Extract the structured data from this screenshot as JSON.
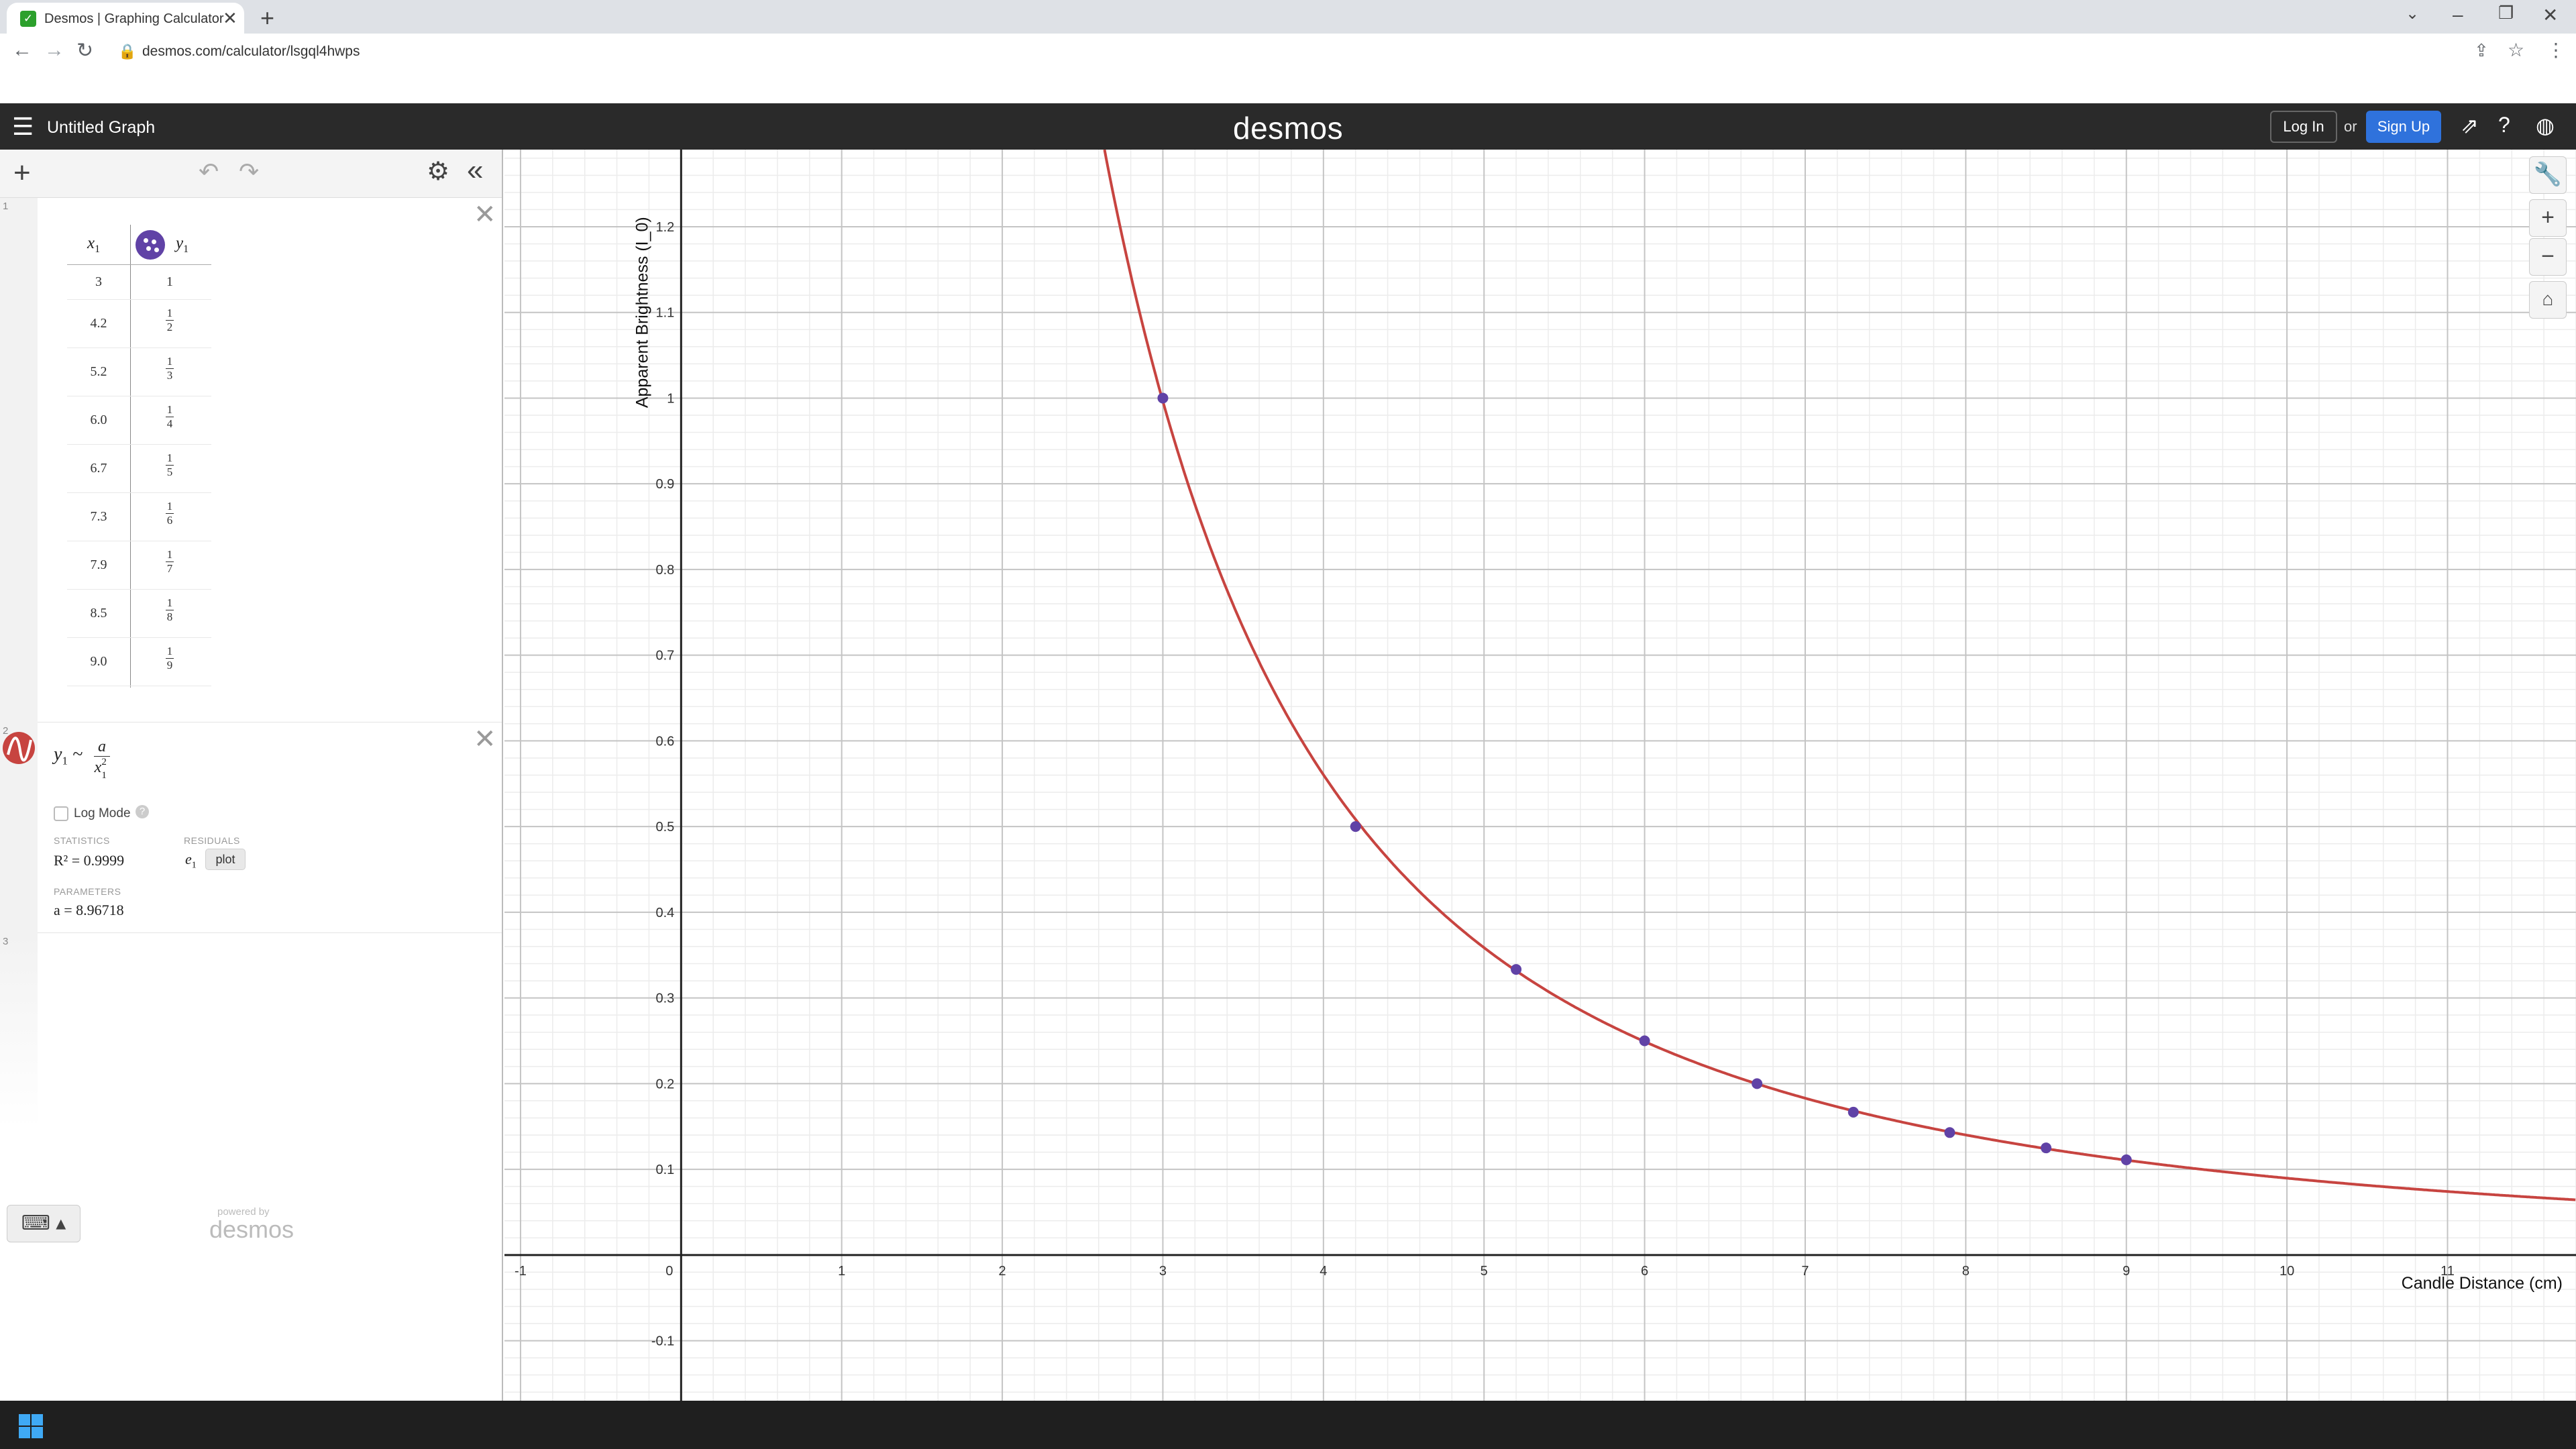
{
  "browser": {
    "tab_title": "Desmos | Graphing Calculator",
    "url": "desmos.com/calculator/lsgql4hwps"
  },
  "header": {
    "graph_title": "Untitled Graph",
    "logo": "desmos",
    "login": "Log In",
    "or": "or",
    "signup": "Sign Up"
  },
  "expressions": {
    "table": {
      "number": "1",
      "x_header": "x",
      "x_sub": "1",
      "y_header": "y",
      "y_sub": "1",
      "rows": [
        {
          "x": "3",
          "y_num": "1",
          "y_den": ""
        },
        {
          "x": "4.2",
          "y_num": "1",
          "y_den": "2"
        },
        {
          "x": "5.2",
          "y_num": "1",
          "y_den": "3"
        },
        {
          "x": "6.0",
          "y_num": "1",
          "y_den": "4"
        },
        {
          "x": "6.7",
          "y_num": "1",
          "y_den": "5"
        },
        {
          "x": "7.3",
          "y_num": "1",
          "y_den": "6"
        },
        {
          "x": "7.9",
          "y_num": "1",
          "y_den": "7"
        },
        {
          "x": "8.5",
          "y_num": "1",
          "y_den": "8"
        },
        {
          "x": "9.0",
          "y_num": "1",
          "y_den": "9"
        }
      ]
    },
    "regression": {
      "number": "2",
      "lhs": "y",
      "lhs_sub": "1",
      "tilde": "~",
      "numerator": "a",
      "denominator": "x",
      "denominator_sup": "2",
      "denominator_sub": "1",
      "log_mode": "Log Mode",
      "log_help": "?",
      "statistics_label": "STATISTICS",
      "residuals_label": "RESIDUALS",
      "parameters_label": "PARAMETERS",
      "r2": "R² = 0.9999",
      "residual_var": "e",
      "residual_sub": "1",
      "plot": "plot",
      "param": "a = 8.96718"
    },
    "empty_number": "3"
  },
  "footer": {
    "powered_by": "powered by",
    "logo": "desmos"
  },
  "chart_data": {
    "type": "scatter",
    "xlabel": "Candle Distance (cm)",
    "ylabel": "Apparent Brightness (I_0)",
    "xlim": [
      -1.1,
      11.8
    ],
    "ylim": [
      -0.17,
      1.29
    ],
    "x_ticks": [
      -1,
      1,
      2,
      3,
      4,
      5,
      6,
      7,
      8,
      9,
      10,
      11
    ],
    "y_ticks": [
      -0.1,
      0.1,
      0.2,
      0.3,
      0.4,
      0.5,
      0.6,
      0.7,
      0.8,
      0.9,
      1,
      1.1,
      1.2
    ],
    "origin_label": "0",
    "points": {
      "x": [
        3,
        4.2,
        5.2,
        6.0,
        6.7,
        7.3,
        7.9,
        8.5,
        9.0
      ],
      "y": [
        1,
        0.5,
        0.3333,
        0.25,
        0.2,
        0.1667,
        0.1429,
        0.125,
        0.1111
      ],
      "color": "#6042a6"
    },
    "curve": {
      "a": 8.96718,
      "color": "#c74440"
    },
    "grid": true
  }
}
